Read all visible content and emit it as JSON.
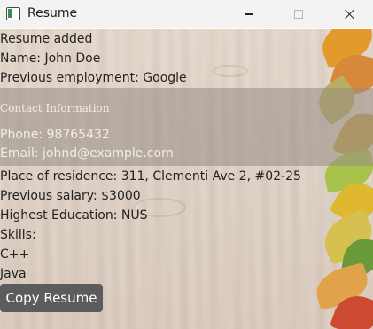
{
  "window": {
    "title": "Resume"
  },
  "resume": {
    "status": "Resume added",
    "name": "Name: John Doe",
    "previous_employment": "Previous employment: Google",
    "contact_heading": "Contact Information",
    "phone": "Phone: 98765432",
    "email": "Email: johnd@example.com",
    "residence": "Place of residence: 311, Clementi Ave 2, #02-25",
    "previous_salary": "Previous salary: $3000",
    "education": "Highest Education: NUS",
    "skills_label": "Skills:",
    "skills": [
      "C++",
      "Java"
    ]
  },
  "actions": {
    "copy_label": "Copy Resume"
  },
  "icons": {
    "app": "app-window-icon",
    "minimize": "minimize-icon",
    "maximize": "maximize-icon",
    "close": "close-icon"
  },
  "colors": {
    "title_bar": "#f3f3f3",
    "button_bg": "#5c5c5c",
    "contact_band": "#968c84"
  }
}
